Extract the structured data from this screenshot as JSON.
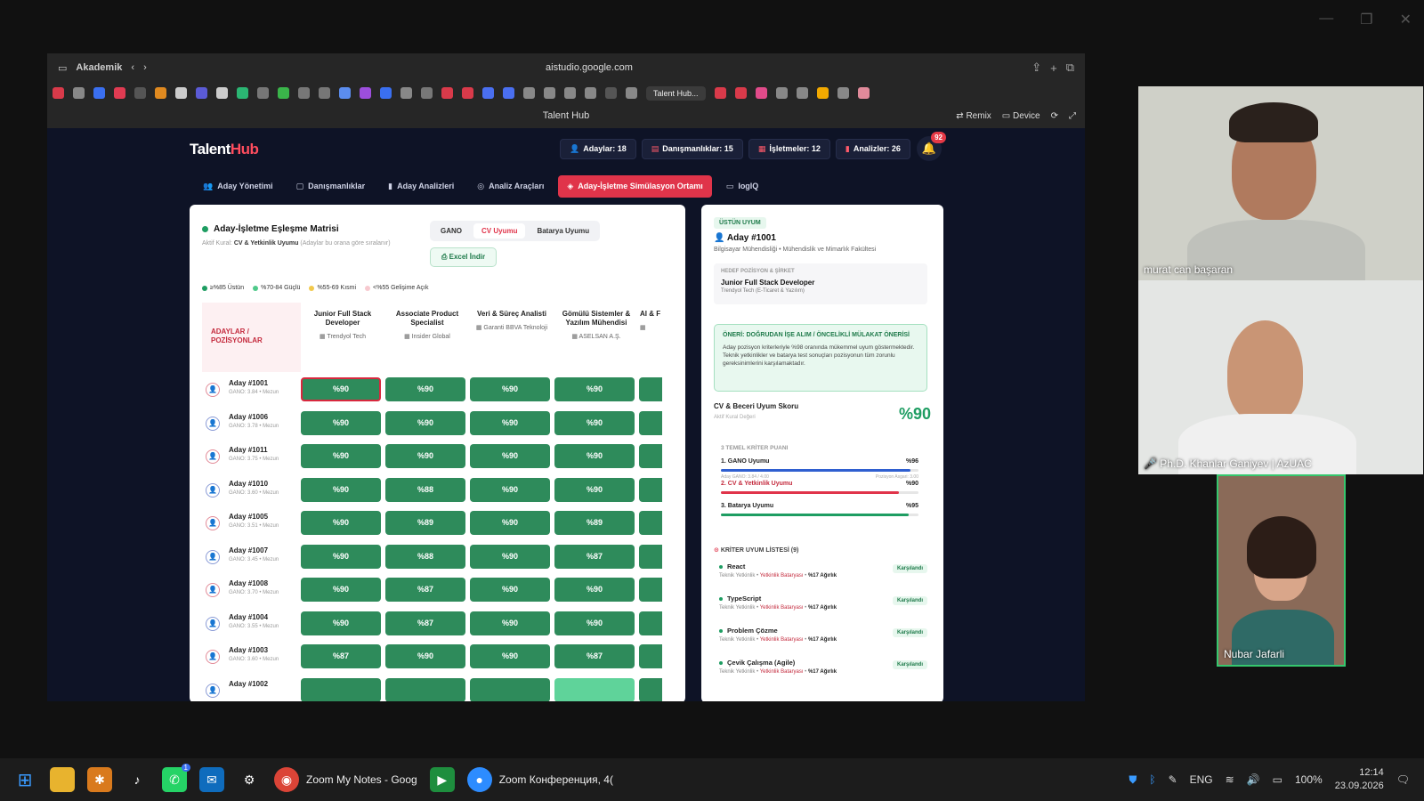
{
  "browser": {
    "group": "Akademik",
    "url": "aistudio.google.com",
    "tab_label": "Talent Hub...",
    "page_title": "Talent Hub",
    "remix": "Remix",
    "device": "Device"
  },
  "app": {
    "logo_a": "Talent",
    "logo_b": "Hub",
    "stats": [
      "Adaylar: 18",
      "Danışmanlıklar: 15",
      "İşletmeler: 12",
      "Analizler: 26"
    ],
    "notif_count": "92",
    "nav": [
      "Aday Yönetimi",
      "Danışmanlıklar",
      "Aday Analizleri",
      "Analiz Araçları",
      "Aday-İşletme Simülasyon Ortamı",
      "IogIQ"
    ]
  },
  "matrix": {
    "title": "Aday-İşletme Eşleşme Matrisi",
    "criterion_label": "Aktif Kural:",
    "criterion_value": "CV & Yetkinlik Uyumu",
    "criterion_note": "(Adaylar bu orana göre sıralanır)",
    "tabs": [
      "GANO",
      "CV Uyumu",
      "Batarya Uyumu"
    ],
    "excel": "Excel İndir",
    "legend": [
      {
        "label": "≥%85 Üstün",
        "color": "#1e9d62"
      },
      {
        "label": "%70-84 Güçlü",
        "color": "#4fc98a"
      },
      {
        "label": "%55-69 Kısmi",
        "color": "#f2c94c"
      },
      {
        "label": "<%55 Gelişime Açık",
        "color": "#f7c9cf"
      }
    ],
    "corner": "ADAYLAR / POZİSYONLAR",
    "columns": [
      {
        "title": "Junior Full Stack Developer",
        "company": "Trendyol Tech"
      },
      {
        "title": "Associate Product Specialist",
        "company": "Insider Global"
      },
      {
        "title": "Veri & Süreç Analisti",
        "company": "Garanti BBVA Teknoloji"
      },
      {
        "title": "Gömülü Sistemler & Yazılım Mühendisi",
        "company": "ASELSAN A.Ş."
      },
      {
        "title": "AI & F",
        "company": ""
      }
    ],
    "rows": [
      {
        "name": "Aday #1001",
        "meta": "GANO: 3.84 • Mezun",
        "values": [
          "%90",
          "%90",
          "%90",
          "%90"
        ]
      },
      {
        "name": "Aday #1006",
        "meta": "GANO: 3.78 • Mezun",
        "values": [
          "%90",
          "%90",
          "%90",
          "%90"
        ]
      },
      {
        "name": "Aday #1011",
        "meta": "GANO: 3.75 • Mezun",
        "values": [
          "%90",
          "%90",
          "%90",
          "%90"
        ]
      },
      {
        "name": "Aday #1010",
        "meta": "GANO: 3.60 • Mezun",
        "values": [
          "%90",
          "%88",
          "%90",
          "%90"
        ]
      },
      {
        "name": "Aday #1005",
        "meta": "GANO: 3.51 • Mezun",
        "values": [
          "%90",
          "%89",
          "%90",
          "%89"
        ]
      },
      {
        "name": "Aday #1007",
        "meta": "GANO: 3.45 • Mezun",
        "values": [
          "%90",
          "%88",
          "%90",
          "%87"
        ]
      },
      {
        "name": "Aday #1008",
        "meta": "GANO: 3.70 • Mezun",
        "values": [
          "%90",
          "%87",
          "%90",
          "%90"
        ]
      },
      {
        "name": "Aday #1004",
        "meta": "GANO: 3.55 • Mezun",
        "values": [
          "%90",
          "%87",
          "%90",
          "%90"
        ]
      },
      {
        "name": "Aday #1003",
        "meta": "GANO: 3.60 • Mezun",
        "values": [
          "%87",
          "%90",
          "%90",
          "%87"
        ]
      },
      {
        "name": "Aday #1002",
        "meta": "",
        "values": [
          "",
          "",
          "",
          ""
        ]
      }
    ]
  },
  "detail": {
    "badge": "ÜSTÜN UYUM",
    "name": "Aday #1001",
    "dept": "Bilgisayar Mühendisliği • Mühendislik ve Mimarlık Fakültesi",
    "target_label": "HEDEF POZİSYON & ŞİRKET",
    "target_title": "Junior Full Stack Developer",
    "target_company": "Trendyol Tech (E-Ticaret & Yazılım)",
    "rec_title": "ÖNERİ: DOĞRUDAN İŞE ALIM / ÖNCELİKLİ MÜLAKAT ÖNERİSİ",
    "rec_text": "Aday pozisyon kriterleriyle %98 oranında mükemmel uyum göstermektedir. Teknik yetkinlikler ve batarya test sonuçları pozisyonun tüm zorunlu gereksinimlerini karşılamaktadır.",
    "score_label": "CV & Beceri Uyum Skoru",
    "score_sub": "Aktif Kural Değeri",
    "score_value": "%90",
    "criteria_title": "3 TEMEL KRİTER PUANI",
    "criteria": [
      {
        "label": "1. GANO Uyumu",
        "value": "%96",
        "fill": 0.96,
        "color": "#2f5fd0",
        "left": "Aday GANO: 3.84 / 4.00",
        "right": "Pozisyon Asgari: 3.00"
      },
      {
        "label": "2. CV & Yetkinlik Uyumu",
        "value": "%90",
        "fill": 0.9,
        "color": "#e0344a",
        "left": "",
        "right": ""
      },
      {
        "label": "3. Batarya Uyumu",
        "value": "%95",
        "fill": 0.95,
        "color": "#1e9d62",
        "left": "",
        "right": ""
      }
    ],
    "list_title": "KRİTER UYUM LİSTESİ (9)",
    "list": [
      {
        "name": "React",
        "type": "Teknik Yetkinlik",
        "src": "Yetkinlik Bataryası",
        "w": "%17 Ağırlık",
        "status": "Karşılandı"
      },
      {
        "name": "TypeScript",
        "type": "Teknik Yetkinlik",
        "src": "Yetkinlik Bataryası",
        "w": "%17 Ağırlık",
        "status": "Karşılandı"
      },
      {
        "name": "Problem Çözme",
        "type": "Teknik Yetkinlik",
        "src": "Yetkinlik Bataryası",
        "w": "%17 Ağırlık",
        "status": "Karşılandı"
      },
      {
        "name": "Çevik Çalışma (Agile)",
        "type": "Teknik Yetkinlik",
        "src": "Yetkinlik Bataryası",
        "w": "%17 Ağırlık",
        "status": "Karşılandı"
      }
    ]
  },
  "participants": [
    "murat can başaran",
    "Ph.D. Khanlar Ganiyev | AzUAC",
    "Nubar Jafarli"
  ],
  "taskbar": {
    "items": [
      "Zoom My Notes - Goog",
      "Zoom Конференция, 4("
    ],
    "lang": "ENG",
    "battery": "100%",
    "time": "12:14",
    "date": "23.09.2026",
    "wa_badge": "1"
  }
}
